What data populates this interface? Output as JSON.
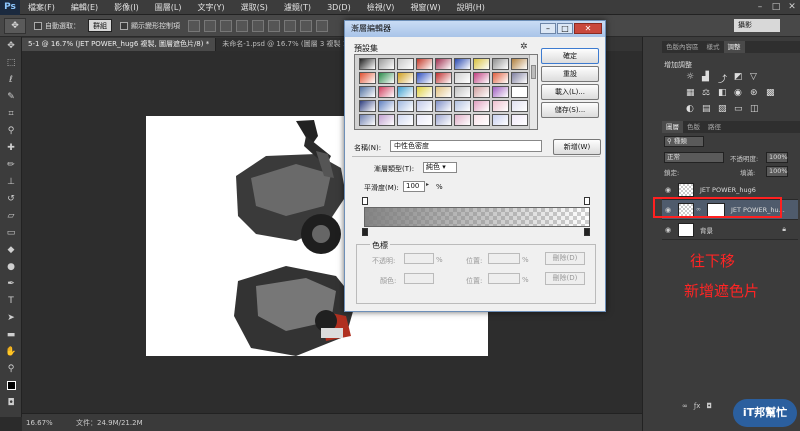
{
  "menubar": {
    "logo": "Ps",
    "items": [
      "檔案(F)",
      "編輯(E)",
      "影像(I)",
      "圖層(L)",
      "文字(Y)",
      "選取(S)",
      "濾鏡(T)",
      "3D(D)",
      "檢視(V)",
      "視窗(W)",
      "說明(H)"
    ]
  },
  "options": {
    "auto_select_label": "自動選取：",
    "auto_select_value": "群組",
    "show_transform_label": "顯示變形控制項",
    "workspace": "攝影"
  },
  "tabs": [
    {
      "label": "5-1 @ 16.7% (JET POWER_hug6 複製, 圖層遮色片/8) *",
      "active": true
    },
    {
      "label": "未命名-1.psd @ 16.7% (圖層 3 複製 11, 圖層遮色片/8)",
      "active": false
    }
  ],
  "status": {
    "zoom": "16.67%",
    "doc": "文件：24.9M/21.2M"
  },
  "dialog": {
    "title": "漸層編輯器",
    "presets_label": "預設集",
    "ok": "確定",
    "reset": "重設",
    "load": "載入(L)...",
    "save": "儲存(S)...",
    "name_label": "名稱(N):",
    "name_value": "中性色密度",
    "new_button": "新增(W)",
    "type_label": "漸層類型(T):",
    "type_value": "純色",
    "smooth_label": "平滑度(M):",
    "smooth_value": "100",
    "smooth_unit": "%",
    "stops_label": "色標",
    "stop_opacity_label": "不透明:",
    "stop_color_label": "顏色:",
    "location_label": "位置:",
    "delete_label": "刪除(D)",
    "percent": "%",
    "swatches": [
      "#222222",
      "#9a9a9a",
      "#c8c8c8",
      "#c43a2a",
      "#a03050",
      "#2a4ab0",
      "#d8c040",
      "#909090",
      "#b08040",
      "#e05030",
      "#2a8a4a",
      "#d0a020",
      "#3050c0",
      "#c03030",
      "#d0d0d0",
      "#c04080",
      "#e06040",
      "#8080a0",
      "#5070a0",
      "#d04060",
      "#40a0d0",
      "#e0d040",
      "#e0c080",
      "#c0c0c0",
      "#d0a0a0",
      "#a060c0",
      "#ffffff",
      "#304080",
      "#6080c0",
      "#a0b8e0",
      "#c0c8e8",
      "#8090c8",
      "#b0c0e0",
      "#e0a0c0",
      "#f0c0d0",
      "#e0e0f0",
      "#7080b0",
      "#c0a0d0",
      "#d0d8f0",
      "#e8e8f8",
      "#a0a8d0",
      "#e0b0c8",
      "#f8e0e8",
      "#c8d0f0",
      "#f0e8f8"
    ]
  },
  "panels": {
    "top_tabs": [
      "色版內容區",
      "樣式",
      "調整"
    ],
    "adj_title": "增加調整",
    "layer_tabs": [
      "圖層",
      "色版",
      "路徑"
    ],
    "filter": "種類",
    "blend": "正常",
    "opacity_label": "不透明度:",
    "opacity_value": "100%",
    "lock_label": "鎖定:",
    "fill_label": "填滿:",
    "fill_value": "100%",
    "layers": [
      {
        "name": "JET POWER_hug6"
      },
      {
        "name": "JET POWER_hu..."
      },
      {
        "name": "背景"
      }
    ]
  },
  "annotations": {
    "line1": "往下移",
    "line2": "新增遮色片"
  },
  "watermark": "iT邦幫忙"
}
